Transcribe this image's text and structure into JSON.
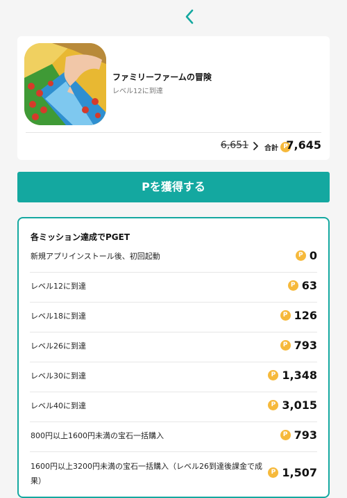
{
  "app": {
    "title": "ファミリーファームの冒険",
    "subtitle": "レベル12に到達"
  },
  "summary": {
    "old_points": "6,651",
    "total_label": "合計",
    "total_points": "7,645"
  },
  "cta": {
    "label": "Pを獲得する"
  },
  "missions": {
    "title": "各ミッション達成でPGET",
    "items": [
      {
        "label": "新規アプリインストール後、初回起動",
        "points": "0"
      },
      {
        "label": "レベル12に到達",
        "points": "63"
      },
      {
        "label": "レベル18に到達",
        "points": "126"
      },
      {
        "label": "レベル26に到達",
        "points": "793"
      },
      {
        "label": "レベル30に到達",
        "points": "1,348"
      },
      {
        "label": "レベル40に到達",
        "points": "3,015"
      },
      {
        "label": "800円以上1600円未満の宝石一括購入",
        "points": "793"
      },
      {
        "label": "1600円以上3200円未満の宝石一括購入（レベル26到達後課金で成果）",
        "points": "1,507"
      }
    ]
  },
  "icons": {
    "back": "chevron-left-icon",
    "arrow": "chevron-right-icon",
    "point": "point-coin-icon"
  },
  "colors": {
    "accent": "#14a8a0",
    "coin": "#f6b93b"
  }
}
